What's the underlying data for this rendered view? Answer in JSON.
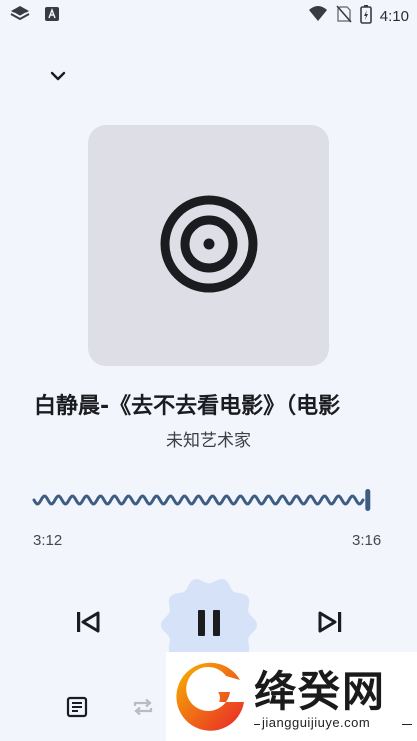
{
  "status_bar": {
    "time": "4:10",
    "icons": [
      "notification-app-icon",
      "keyboard-a-icon",
      "wifi-icon",
      "no-sim-icon",
      "battery-charging-icon"
    ]
  },
  "player": {
    "collapse_icon": "chevron-down-icon",
    "artwork_icon": "vinyl-disc-icon",
    "title": "白静晨-《去不去看电影》（电影",
    "artist": "未知艺术家",
    "elapsed": "3:12",
    "duration": "3:16",
    "progress": 0.98,
    "accent_color": "#3d5d83",
    "play_button_color": "#d6e2f8"
  },
  "controls": {
    "previous_icon": "skip-previous-icon",
    "play_state_icon": "pause-icon",
    "next_icon": "skip-next-icon",
    "lyrics_icon": "lyrics-icon",
    "repeat_icon": "repeat-icon"
  },
  "watermark": {
    "name": "绛癸网",
    "domain": "jiangguijiuye.com"
  }
}
